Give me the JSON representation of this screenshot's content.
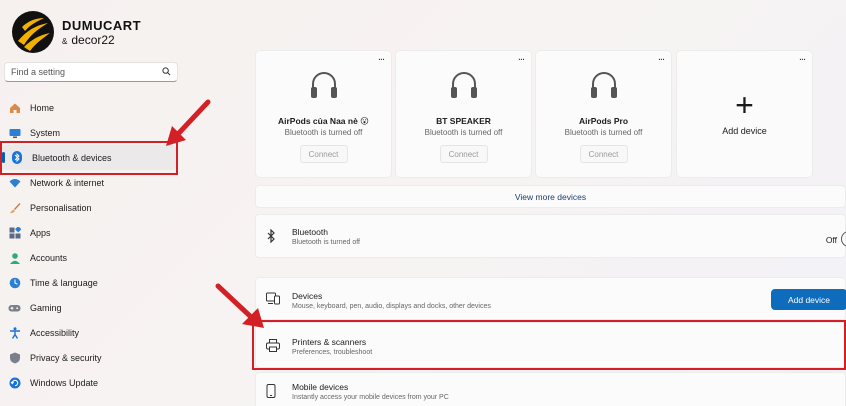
{
  "logo": {
    "title": "DUMUCART",
    "amp": "&",
    "subtitle": "decor22"
  },
  "search": {
    "placeholder": "Find a setting"
  },
  "sidebar": {
    "items": [
      {
        "label": "Home",
        "icon": "home-icon"
      },
      {
        "label": "System",
        "icon": "display-icon"
      },
      {
        "label": "Bluetooth & devices",
        "icon": "bluetooth-icon"
      },
      {
        "label": "Network & internet",
        "icon": "wifi-icon"
      },
      {
        "label": "Personalisation",
        "icon": "brush-icon"
      },
      {
        "label": "Apps",
        "icon": "apps-icon"
      },
      {
        "label": "Accounts",
        "icon": "person-icon"
      },
      {
        "label": "Time & language",
        "icon": "globe-clock-icon"
      },
      {
        "label": "Gaming",
        "icon": "gamepad-icon"
      },
      {
        "label": "Accessibility",
        "icon": "accessibility-icon"
      },
      {
        "label": "Privacy & security",
        "icon": "shield-icon"
      },
      {
        "label": "Windows Update",
        "icon": "update-icon"
      }
    ]
  },
  "devices": [
    {
      "name": "AirPods của Naa nè 😮",
      "status": "Bluetooth is turned off",
      "button": "Connect",
      "more": "..."
    },
    {
      "name": "BT SPEAKER",
      "status": "Bluetooth is turned off",
      "button": "Connect",
      "more": "..."
    },
    {
      "name": "AirPods Pro",
      "status": "Bluetooth is turned off",
      "button": "Connect",
      "more": "..."
    }
  ],
  "add_card": {
    "label": "Add device",
    "symbol": "+",
    "more": "..."
  },
  "view_more": "View more devices",
  "bluetooth_row": {
    "title": "Bluetooth",
    "subtitle": "Bluetooth is turned off",
    "toggle": "Off"
  },
  "devices_row": {
    "title": "Devices",
    "subtitle": "Mouse, keyboard, pen, audio, displays and docks, other devices",
    "button": "Add device"
  },
  "printers_row": {
    "title": "Printers & scanners",
    "subtitle": "Preferences, troubleshoot"
  },
  "mobile_row": {
    "title": "Mobile devices",
    "subtitle": "Instantly access your mobile devices from your PC"
  },
  "colors": {
    "accent": "#0f6cbd",
    "highlight": "#d32027"
  }
}
